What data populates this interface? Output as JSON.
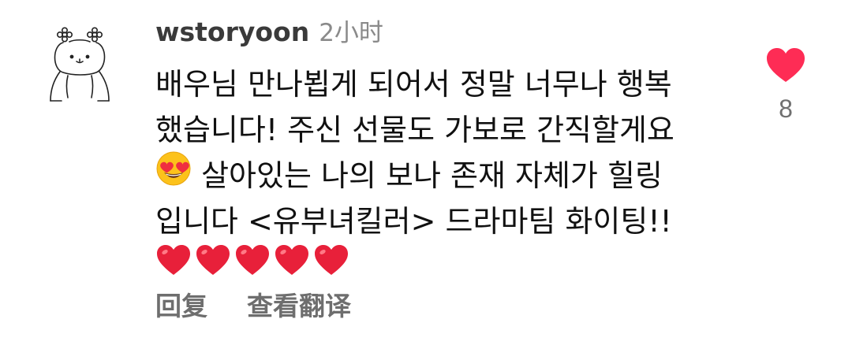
{
  "comment": {
    "username": "wstoryoon",
    "time": "2小时",
    "body_lines": [
      "배우님 만나뵙게 되어서 정말 너무나 행복",
      "했습니다! 주신 선물도 가보로 간직할게요",
      " 살아있는 나의 보나 존재 자체가 힐링",
      "입니다 <유부녀킬러> 드라마팀 화이팅!!"
    ],
    "emojis": {
      "line3_leading": "smiling-face-with-heart-eyes",
      "line5": [
        "red-heart",
        "red-heart",
        "red-heart",
        "red-heart",
        "red-heart"
      ]
    },
    "actions": {
      "reply_label": "回复",
      "translate_label": "查看翻译"
    },
    "likes": {
      "count": "8",
      "liked": true,
      "color": "#fe2c55"
    },
    "avatar": "bear-with-flowers-sketch"
  }
}
